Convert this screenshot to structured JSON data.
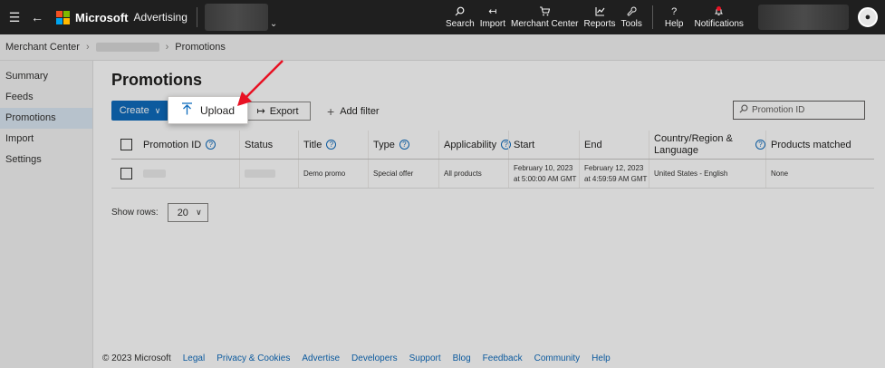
{
  "topbar": {
    "menu_icon": "hamburger-icon",
    "back_icon": "back-arrow-icon",
    "brand": "Microsoft",
    "product": "Advertising",
    "logo_colors": [
      "#f25022",
      "#7fba00",
      "#00a4ef",
      "#ffb900"
    ],
    "tools": [
      {
        "label": "Search",
        "icon": "search-icon"
      },
      {
        "label": "Import",
        "icon": "import-icon"
      },
      {
        "label": "Merchant Center",
        "icon": "cart-icon"
      },
      {
        "label": "Reports",
        "icon": "reports-icon"
      },
      {
        "label": "Tools",
        "icon": "wrench-icon"
      }
    ],
    "help_label": "Help",
    "notifications_label": "Notifications"
  },
  "breadcrumb": {
    "root": "Merchant Center",
    "current": "Promotions"
  },
  "sidebar": {
    "items": [
      {
        "label": "Summary"
      },
      {
        "label": "Feeds"
      },
      {
        "label": "Promotions"
      },
      {
        "label": "Import"
      },
      {
        "label": "Settings"
      }
    ],
    "active": "Promotions"
  },
  "main": {
    "title": "Promotions",
    "create_label": "Create",
    "upload_label": "Upload",
    "export_label": "Export",
    "add_filter_label": "Add filter",
    "search_placeholder": "Promotion ID",
    "accent_color": "#0f6cbd"
  },
  "table": {
    "columns": [
      "Promotion ID",
      "Status",
      "Title",
      "Type",
      "Applicability",
      "Start",
      "End",
      "Country/Region & Language",
      "Products matched"
    ],
    "rows": [
      {
        "title": "Demo promo",
        "type": "Special offer",
        "applicability": "All products",
        "start_date": "February 10, 2023",
        "start_time": "at 5:00:00 AM GMT",
        "end_date": "February 12, 2023",
        "end_time": "at 4:59:59 AM GMT",
        "country": "United States - English",
        "products_matched": "None"
      }
    ]
  },
  "pagination": {
    "show_rows_label": "Show rows:",
    "rows_value": "20"
  },
  "footer": {
    "copyright": "© 2023 Microsoft",
    "links": [
      "Legal",
      "Privacy & Cookies",
      "Advertise",
      "Developers",
      "Support",
      "Blog",
      "Feedback",
      "Community",
      "Help"
    ]
  },
  "annotation": {
    "arrow_color": "#e81123"
  }
}
